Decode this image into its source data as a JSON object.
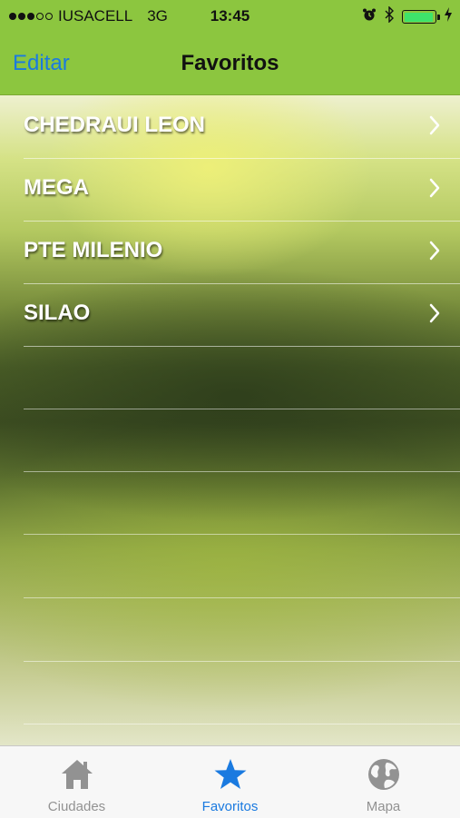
{
  "status_bar": {
    "carrier": "IUSACELL",
    "network": "3G",
    "time": "13:45",
    "battery_level": 0.95
  },
  "nav": {
    "edit_label": "Editar",
    "title": "Favoritos"
  },
  "favorites": [
    {
      "label": "CHEDRAUI LEON"
    },
    {
      "label": "MEGA"
    },
    {
      "label": "PTE MILENIO"
    },
    {
      "label": "SILAO"
    }
  ],
  "tabs": [
    {
      "label": "Ciudades",
      "icon": "house-icon",
      "active": false
    },
    {
      "label": "Favoritos",
      "icon": "star-icon",
      "active": true
    },
    {
      "label": "Mapa",
      "icon": "globe-icon",
      "active": false
    }
  ],
  "colors": {
    "bar_green": "#8cc63f",
    "tint_blue": "#1a7ae0",
    "inactive_gray": "#929292"
  }
}
